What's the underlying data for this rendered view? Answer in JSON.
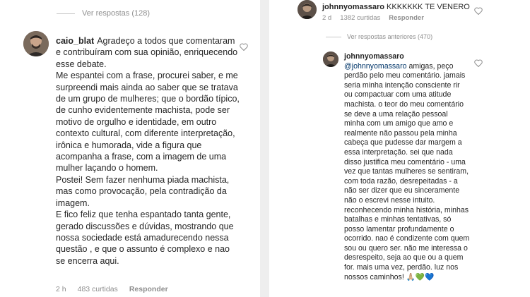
{
  "left": {
    "view_replies": "Ver respostas (128)",
    "comment": {
      "username": "caio_blat",
      "paragraphs": [
        "Agradeço a todos que comentaram e contribuíram com sua opinião, enriquecendo esse debate.",
        "Me espantei com a frase, procurei saber, e me surpreendi mais ainda ao saber que se tratava de um grupo de mulheres; que o bordão típico, de cunho evidentemente machista, pode ser motivo de orgulho e identidade, em outro contexto cultural, com diferente interpretação, irônica e humorada, vide a figura que acompanha a frase, com a imagem de uma mulher laçando o homem.",
        "Postei! Sem fazer nenhuma piada machista, mas como provocação, pela contradição da imagem.",
        "E fico feliz que tenha espantado tanta gente, gerado discussões  e dúvidas, mostrando que nossa sociedade está amadurecendo nessa questão , e que o assunto é complexo e nao se encerra aqui."
      ],
      "time": "2 h",
      "likes": "483 curtidas",
      "reply": "Responder"
    }
  },
  "right": {
    "top_comment": {
      "username": "johnnyomassaro",
      "text": "KKKKKKK TE VENERO",
      "time": "2 d",
      "likes": "1382 curtidas",
      "reply": "Responder"
    },
    "view_prev_replies": "Ver respostas anteriores (470)",
    "reply_comment": {
      "username": "johnnyomassaro",
      "mention": "@johnnyomassaro",
      "text": "amigas, peço perdão pelo meu comentário. jamais seria minha intenção consciente rir ou compactuar com uma atitude machista. o teor do meu comentário se deve a uma relação pessoal minha com um amigo que amo e realmente não passou pela minha cabeça que pudesse dar margem a essa interpretação. sei que nada disso justifica meu comentário - uma vez que tantas mulheres se sentiram, com toda razão, desrepeitadas - a não ser dizer que eu sinceramente não o escrevi nesse intuito. reconhecendo minha história, minhas batalhas e minhas tentativas, só posso lamentar profundamente o ocorrido. nao é condizente com quem sou ou quero ser. não me interessa o desrespeito, seja ao que ou a quem for. mais uma vez, perdão. luz nos nossos caminhos! 🙏🏼💚💙"
    }
  },
  "colors": {
    "text": "#262626",
    "muted": "#8e8e8e",
    "mention": "#003569"
  }
}
